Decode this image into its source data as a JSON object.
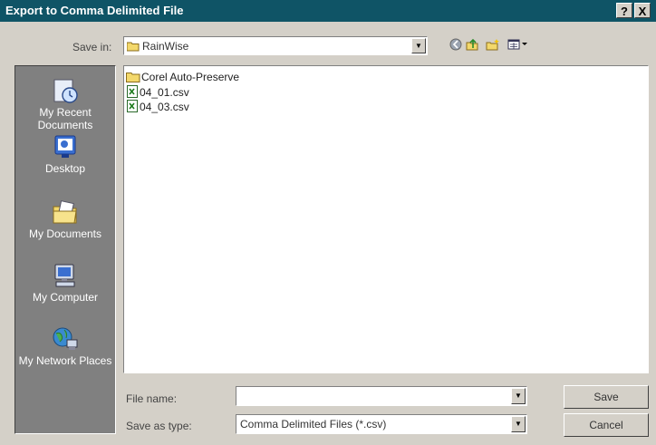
{
  "window": {
    "title": "Export to Comma Delimited File",
    "help_label": "?",
    "close_label": "X"
  },
  "save_in": {
    "label": "Save in:",
    "value": "RainWise"
  },
  "toolbar": {
    "icons": [
      "back-icon",
      "up-folder-icon",
      "new-folder-icon",
      "view-menu-icon"
    ]
  },
  "places": [
    {
      "label": "My Recent Documents",
      "icon": "recent-documents-icon"
    },
    {
      "label": "Desktop",
      "icon": "desktop-icon"
    },
    {
      "label": "My Documents",
      "icon": "my-documents-icon"
    },
    {
      "label": "My Computer",
      "icon": "my-computer-icon"
    },
    {
      "label": "My Network Places",
      "icon": "network-places-icon"
    }
  ],
  "files": [
    {
      "name": "Corel Auto-Preserve",
      "type": "folder"
    },
    {
      "name": "04_01.csv",
      "type": "csv"
    },
    {
      "name": "04_03.csv",
      "type": "csv"
    }
  ],
  "file_name": {
    "label": "File name:",
    "value": ""
  },
  "save_as_type": {
    "label": "Save as type:",
    "value": "Comma Delimited Files (*.csv)"
  },
  "buttons": {
    "save": "Save",
    "cancel": "Cancel"
  },
  "colors": {
    "title_bar": "#0f5466",
    "dialog_face": "#d4d0c8",
    "places_bar": "#808080"
  }
}
